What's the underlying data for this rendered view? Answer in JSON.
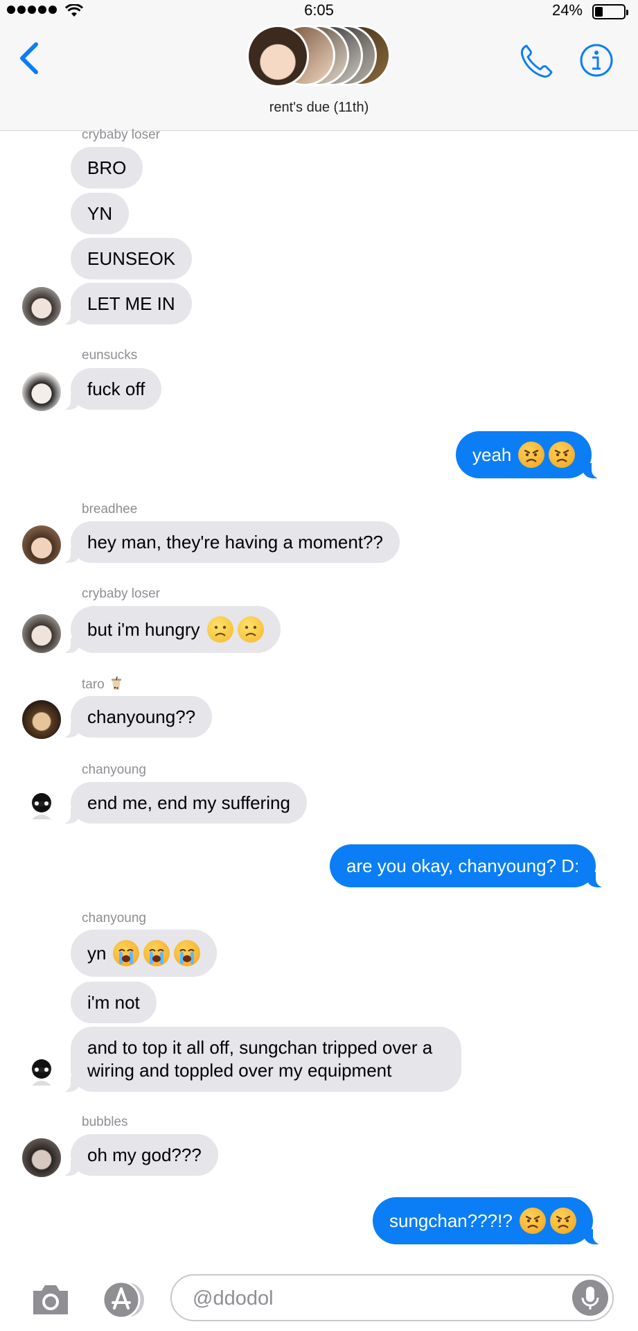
{
  "status_bar": {
    "time": "6:05",
    "battery": "24%",
    "battery_level": 0.24
  },
  "header": {
    "title": "rent's due (11th)",
    "icons": [
      "chevron-left-icon",
      "phone-icon",
      "info-icon"
    ]
  },
  "colors": {
    "accent": "#0b7ef5",
    "received_bubble": "#e5e5ea",
    "meta_text": "#8e8e93"
  },
  "messages": [
    {
      "sender": "crybaby loser",
      "direction": "received",
      "texts": [
        "BRO",
        "YN",
        "EUNSEOK",
        "LET ME IN"
      ]
    },
    {
      "sender": "eunsucks",
      "direction": "received",
      "texts": [
        "fuck off"
      ]
    },
    {
      "direction": "sent",
      "text": "yeah",
      "emoji": [
        "pouting-face",
        "pouting-face"
      ]
    },
    {
      "sender": "breadhee",
      "direction": "received",
      "texts": [
        "hey man, they're having a moment??"
      ]
    },
    {
      "sender": "crybaby loser",
      "direction": "received",
      "texts": [
        "but i'm hungry"
      ],
      "emoji": [
        "frowning-face",
        "frowning-face"
      ]
    },
    {
      "sender": "taro",
      "sender_emoji": "bubble-tea-icon",
      "direction": "received",
      "texts": [
        "chanyoung??"
      ]
    },
    {
      "sender": "chanyoung",
      "direction": "received",
      "texts": [
        "end me, end my suffering"
      ]
    },
    {
      "direction": "sent",
      "text": "are you okay, chanyoung? D:"
    },
    {
      "sender": "chanyoung",
      "direction": "received",
      "texts": [
        "yn",
        "i'm not",
        "and to top it all off, sungchan tripped over a wiring and toppled over my equipment"
      ],
      "emoji_first": [
        "crying-face",
        "crying-face",
        "crying-face"
      ]
    },
    {
      "sender": "bubbles",
      "direction": "received",
      "texts": [
        "oh my god???"
      ]
    },
    {
      "direction": "sent",
      "text": "sungchan???!?",
      "emoji": [
        "pouting-face",
        "pouting-face"
      ]
    }
  ],
  "input_bar": {
    "placeholder": "@ddodol"
  }
}
